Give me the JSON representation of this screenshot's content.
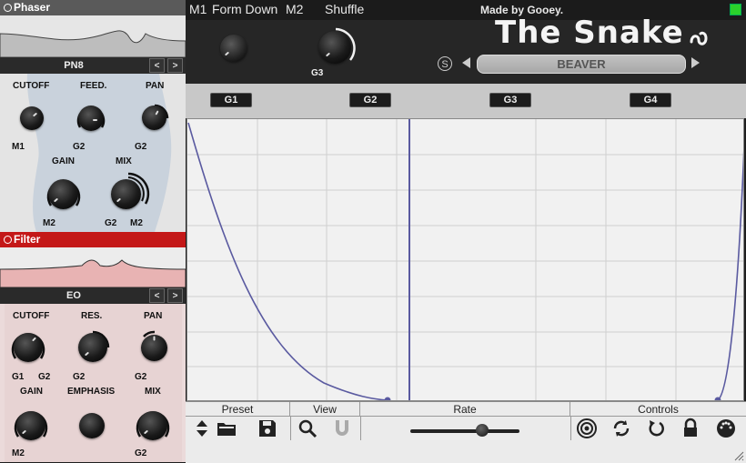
{
  "left_panel": {
    "phaser": {
      "title": "Phaser",
      "preset": "PN8",
      "prev": "<",
      "next": ">",
      "knobs": [
        {
          "label": "CUTOFF",
          "mod": "M1"
        },
        {
          "label": "FEED.",
          "mod": "G2"
        },
        {
          "label": "PAN",
          "mod": "G2"
        },
        {
          "label": "GAIN",
          "mod": "M2"
        },
        {
          "label": "MIX",
          "mod": "G2",
          "mod2": "M2"
        }
      ]
    },
    "filter": {
      "title": "Filter",
      "preset": "EO",
      "prev": "<",
      "next": ">",
      "knobs": [
        {
          "label": "CUTOFF",
          "mod": "G1",
          "mod2": "G2"
        },
        {
          "label": "RES.",
          "mod": "G2"
        },
        {
          "label": "PAN",
          "mod": "G2"
        },
        {
          "label": "GAIN",
          "mod": "M2"
        },
        {
          "label": "EMPHASIS",
          "mod": ""
        },
        {
          "label": "MIX",
          "mod": "G2"
        }
      ]
    }
  },
  "top_bar": {
    "m1": "M1",
    "macro_name": "Form Down",
    "m2": "M2",
    "shuffle": "Shuffle",
    "made_by": "Made by Gooey."
  },
  "header": {
    "title": "The Snake",
    "knob_label": "G3",
    "s_button": "S",
    "preset_name": "BEAVER"
  },
  "graph_tabs": [
    "G1",
    "G2",
    "G3",
    "G4"
  ],
  "bottom": {
    "preset": "Preset",
    "view": "View",
    "rate": "Rate",
    "controls": "Controls"
  },
  "colors": {
    "filter_red": "#cc1a1a",
    "curve": "#5a5aa0",
    "panel_dark": "#262626"
  }
}
